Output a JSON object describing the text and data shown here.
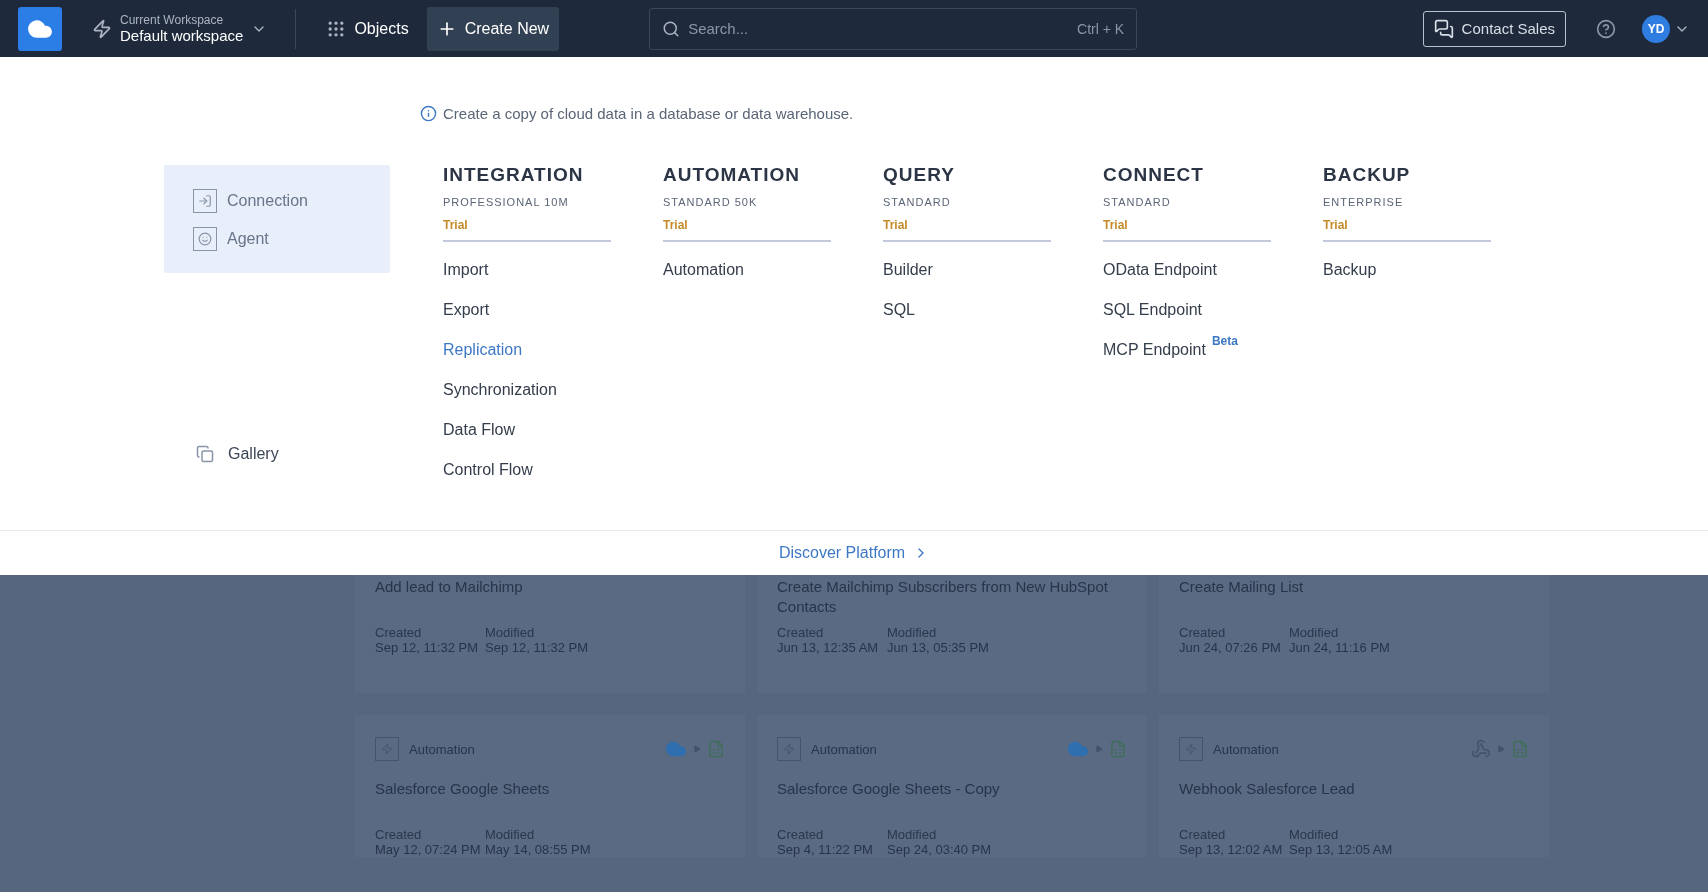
{
  "topbar": {
    "workspace_label": "Current Workspace",
    "workspace_name": "Default workspace",
    "objects": "Objects",
    "create_new": "Create New",
    "search": {
      "placeholder": "Search...",
      "shortcut": "Ctrl + K"
    },
    "contact_sales": "Contact Sales",
    "avatar": "YD"
  },
  "info": "Create a copy of cloud data in a database or data warehouse.",
  "sidebar": {
    "items": [
      {
        "label": "Connection",
        "kind": "connection"
      },
      {
        "label": "Agent",
        "kind": "agent"
      }
    ],
    "gallery": "Gallery"
  },
  "products": [
    {
      "title": "INTEGRATION",
      "plan": "PROFESSIONAL 10M",
      "status": "Trial",
      "items": [
        {
          "label": "Import",
          "hovered": false
        },
        {
          "label": "Export",
          "hovered": false
        },
        {
          "label": "Replication",
          "hovered": true
        },
        {
          "label": "Synchronization",
          "hovered": false
        },
        {
          "label": "Data Flow",
          "hovered": false
        },
        {
          "label": "Control Flow",
          "hovered": false
        }
      ]
    },
    {
      "title": "AUTOMATION",
      "plan": "STANDARD 50K",
      "status": "Trial",
      "items": [
        {
          "label": "Automation",
          "hovered": false
        }
      ]
    },
    {
      "title": "QUERY",
      "plan": "STANDARD",
      "status": "Trial",
      "items": [
        {
          "label": "Builder",
          "hovered": false
        },
        {
          "label": "SQL",
          "hovered": false
        }
      ]
    },
    {
      "title": "CONNECT",
      "plan": "STANDARD",
      "status": "Trial",
      "items": [
        {
          "label": "OData Endpoint",
          "hovered": false
        },
        {
          "label": "SQL Endpoint",
          "hovered": false
        },
        {
          "label": "MCP Endpoint",
          "hovered": false,
          "badge": "Beta"
        }
      ]
    },
    {
      "title": "BACKUP",
      "plan": "ENTERPRISE",
      "status": "Trial",
      "items": [
        {
          "label": "Backup",
          "hovered": false
        }
      ]
    }
  ],
  "footer_link": "Discover Platform",
  "background_cards": [
    {
      "title": "Add lead to Mailchimp",
      "created_label": "Created",
      "created": "Sep 12, 11:32 PM",
      "modified_label": "Modified",
      "modified": "Sep 12, 11:32 PM"
    },
    {
      "title": "Create Mailchimp Subscribers from New HubSpot Contacts",
      "created_label": "Created",
      "created": "Jun 13, 12:35 AM",
      "modified_label": "Modified",
      "modified": "Jun 13, 05:35 PM"
    },
    {
      "title": "Create Mailing List",
      "created_label": "Created",
      "created": "Jun 24, 07:26 PM",
      "modified_label": "Modified",
      "modified": "Jun 24, 11:16 PM"
    },
    {
      "type_label": "Automation",
      "kind": "salesforce",
      "title": "Salesforce Google Sheets",
      "created_label": "Created",
      "created": "May 12, 07:24 PM",
      "modified_label": "Modified",
      "modified": "May 14, 08:55 PM"
    },
    {
      "type_label": "Automation",
      "kind": "salesforce",
      "title": "Salesforce Google Sheets - Copy",
      "created_label": "Created",
      "created": "Sep 4, 11:22 PM",
      "modified_label": "Modified",
      "modified": "Sep 24, 03:40 PM"
    },
    {
      "type_label": "Automation",
      "kind": "webhook",
      "title": "Webhook Salesforce Lead",
      "created_label": "Created",
      "created": "Sep 13, 12:02 AM",
      "modified_label": "Modified",
      "modified": "Sep 13, 12:05 AM"
    }
  ]
}
